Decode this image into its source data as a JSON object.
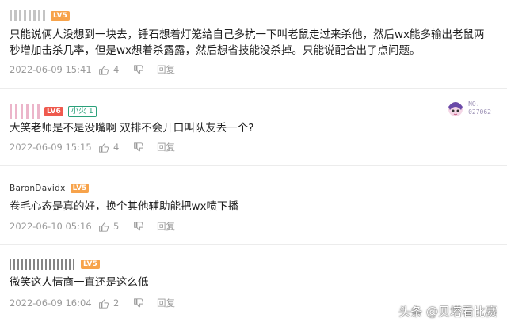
{
  "comments": [
    {
      "name": "",
      "level": "LV5",
      "text": "只能说俩人没想到一块去，锤石想着灯笼给自己多抗一下叫老鼠走过来杀他，然后wx能多输出老鼠两秒增加击杀几率，但是wx想着杀露露，然后想省技能没杀掉。只能说配合出了点问题。",
      "date": "2022-06-09 15:41",
      "likes": "4",
      "reply": "回复"
    },
    {
      "name": "",
      "level": "LV6",
      "fire_badge": "小火 1",
      "text": "大笑老师是不是没嘴啊 双排不会开口叫队友丢一个?",
      "date": "2022-06-09 15:15",
      "likes": "4",
      "reply": "回复",
      "medal_no_label": "NO.",
      "medal_no_value": "027062"
    },
    {
      "name": "BaronDavidx",
      "level": "LV5",
      "text": "卷毛心态是真的好，换个其他辅助能把wx喷下播",
      "date": "2022-06-10 05:16",
      "likes": "5",
      "reply": "回复"
    },
    {
      "name": "",
      "level": "LV5",
      "text": "微笑这人情商一直还是这么低",
      "date": "2022-06-09 16:04",
      "likes": "2",
      "reply": "回复"
    }
  ],
  "watermark": "头条 @贝塔看比赛",
  "colors": {
    "lv5": "#f7a34b",
    "lv6": "#ef5a4e",
    "fire": "#2aa07a",
    "meta": "#9a9a9a"
  },
  "icons": {
    "like": "thumb-up-icon",
    "dislike": "thumb-down-icon",
    "medal": "anime-avatar-medal-icon"
  }
}
